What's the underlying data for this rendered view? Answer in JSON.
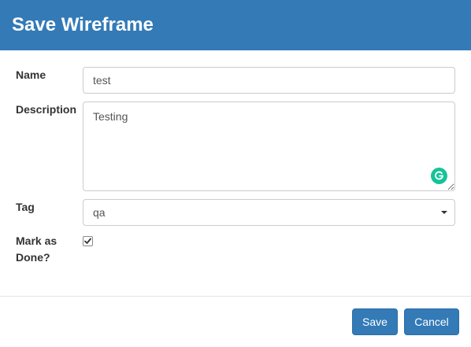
{
  "dialog": {
    "title": "Save Wireframe"
  },
  "form": {
    "name": {
      "label": "Name",
      "value": "test"
    },
    "description": {
      "label": "Description",
      "value": "Testing",
      "grammarly_icon": "grammarly-icon"
    },
    "tag": {
      "label": "Tag",
      "selected": "qa",
      "caret_icon": "caret-down-icon"
    },
    "done": {
      "label_line1": "Mark as",
      "label_line2": "Done?",
      "checked": true
    }
  },
  "footer": {
    "save_label": "Save",
    "cancel_label": "Cancel"
  },
  "colors": {
    "header": "#337ab7",
    "primary_button": "#337ab7",
    "grammarly": "#15c39a"
  }
}
